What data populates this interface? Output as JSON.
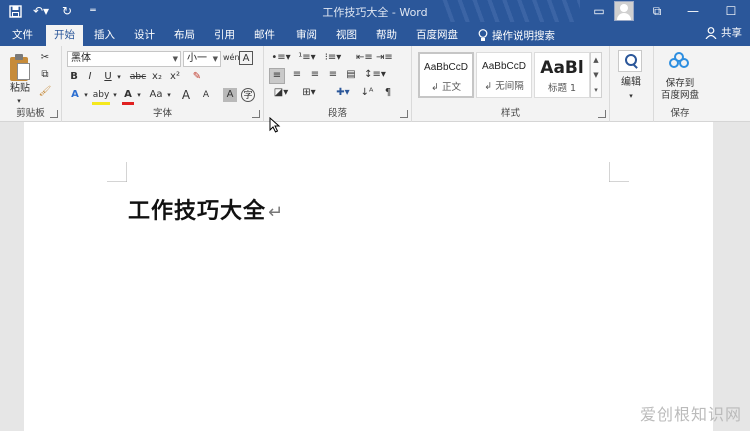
{
  "title_bar": {
    "title": "工作技巧大全 - Word",
    "qat": [
      "save",
      "undo",
      "redo",
      "customize"
    ]
  },
  "tabs": [
    {
      "label": "文件",
      "active": false
    },
    {
      "label": "开始",
      "active": true
    },
    {
      "label": "插入",
      "active": false
    },
    {
      "label": "设计",
      "active": false
    },
    {
      "label": "布局",
      "active": false
    },
    {
      "label": "引用",
      "active": false
    },
    {
      "label": "邮件",
      "active": false
    },
    {
      "label": "审阅",
      "active": false
    },
    {
      "label": "视图",
      "active": false
    },
    {
      "label": "帮助",
      "active": false
    },
    {
      "label": "百度网盘",
      "active": false
    }
  ],
  "tell_me": "操作说明搜索",
  "share": "共享",
  "ribbon": {
    "clipboard": {
      "label": "剪贴板",
      "paste": "粘贴"
    },
    "font": {
      "label": "字体",
      "font_name": "黑体",
      "font_size": "小一",
      "buttons": [
        "B",
        "I",
        "U",
        "abc",
        "x₂",
        "x²",
        "A",
        "Aa",
        "A",
        "A"
      ]
    },
    "paragraph": {
      "label": "段落"
    },
    "styles": {
      "label": "样式",
      "items": [
        {
          "sample": "AaBbCcD",
          "name": "↲ 正文"
        },
        {
          "sample": "AaBbCcD",
          "name": "↲ 无间隔"
        },
        {
          "sample": "AaBl",
          "name": "标题 1"
        }
      ]
    },
    "editing": {
      "label": "编辑"
    },
    "save": {
      "label": "保存",
      "button": "保存到\n百度网盘"
    }
  },
  "document": {
    "heading": "工作技巧大全",
    "paragraph_mark": "↵"
  },
  "watermark": "爱创根知识网",
  "colors": {
    "accent": "#2b579a",
    "ribbon": "#f3f3f3",
    "page": "#ffffff",
    "canvas": "#e6e6e6"
  }
}
